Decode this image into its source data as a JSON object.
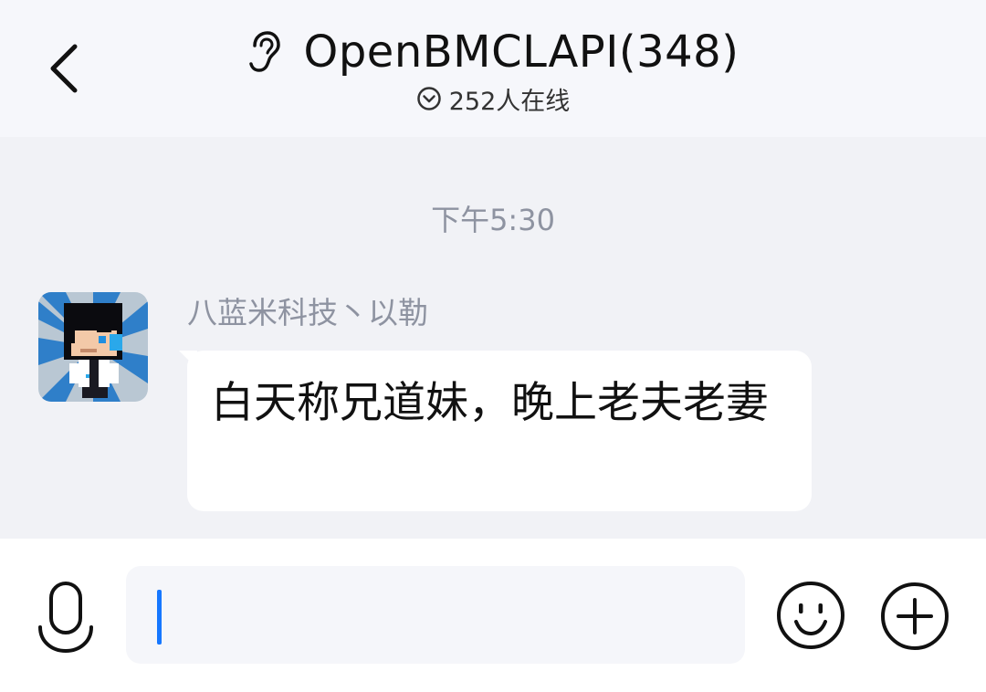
{
  "header": {
    "group_name": "OpenBMCLAPI(348)",
    "online_status": "252人在线",
    "ear_icon": "ear-icon",
    "back_icon": "chevron-left-icon"
  },
  "chat": {
    "timestamp": "下午5:30",
    "messages": [
      {
        "sender": "八蓝米科技丶以勒",
        "text": "白天称兄道妹，晚上老夫老妻",
        "avatar": "pixel-avatar"
      }
    ]
  },
  "input_bar": {
    "value": "",
    "mic_icon": "microphone-icon",
    "emoji_icon": "smiley-icon",
    "plus_icon": "plus-circle-icon",
    "caret_color": "#1677ff"
  }
}
